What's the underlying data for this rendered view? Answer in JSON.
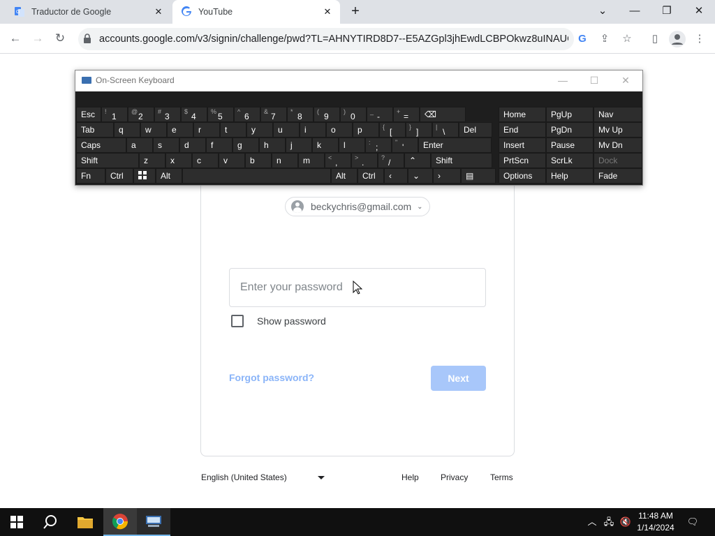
{
  "browser": {
    "tabs": [
      {
        "title": "Traductor de Google",
        "active": false
      },
      {
        "title": "YouTube",
        "active": true
      }
    ],
    "new_tab_glyph": "+",
    "url": "accounts.google.com/v3/signin/challenge/pwd?TL=AHNYTIRD8D7--E5AZGpl3jhEwdLCBPOkwz8uINAUOPB..."
  },
  "osk": {
    "title": "On-Screen Keyboard",
    "keys": {
      "row1": [
        "Esc",
        "1",
        "2",
        "3",
        "4",
        "5",
        "6",
        "7",
        "8",
        "9",
        "0",
        "-",
        "="
      ],
      "row1_shift": [
        "~ `",
        "!",
        "@",
        "#",
        "$",
        "%",
        "^",
        "&",
        "*",
        "(",
        ")",
        "_",
        "+"
      ],
      "row2": [
        "Tab",
        "q",
        "w",
        "e",
        "r",
        "t",
        "y",
        "u",
        "i",
        "o",
        "p",
        "[",
        "]",
        "\\",
        "Del"
      ],
      "row2_shift": [
        "",
        "",
        "",
        "",
        "",
        "",
        "",
        "",
        "",
        "",
        "",
        "{",
        "}",
        "|",
        ""
      ],
      "row3": [
        "Caps",
        "a",
        "s",
        "d",
        "f",
        "g",
        "h",
        "j",
        "k",
        "l",
        ";",
        "'",
        "Enter"
      ],
      "row3_shift": [
        "",
        "",
        "",
        "",
        "",
        "",
        "",
        "",
        "",
        "",
        ":",
        "\"",
        ""
      ],
      "row4": [
        "Shift",
        "z",
        "x",
        "c",
        "v",
        "b",
        "n",
        "m",
        ",",
        ".",
        "/",
        "",
        "Shift"
      ],
      "row4_shift": [
        "",
        "",
        "",
        "",
        "",
        "",
        "",
        "",
        "<",
        ">",
        "?",
        "",
        ""
      ],
      "row5": [
        "Fn",
        "Ctrl",
        "",
        "Alt",
        "",
        "Alt",
        "Ctrl",
        "",
        "",
        "",
        ""
      ],
      "nav": [
        [
          "Home",
          "PgUp",
          "Nav"
        ],
        [
          "End",
          "PgDn",
          "Mv Up"
        ],
        [
          "Insert",
          "Pause",
          "Mv Dn"
        ],
        [
          "PrtScn",
          "ScrLk",
          "Dock"
        ],
        [
          "Options",
          "Help",
          "Fade"
        ]
      ]
    }
  },
  "signin": {
    "account_email": "beckychris@gmail.com",
    "password_placeholder": "Enter your password",
    "show_password_label": "Show password",
    "forgot_password": "Forgot password?",
    "next_label": "Next"
  },
  "footer": {
    "language": "English (United States)",
    "links": [
      "Help",
      "Privacy",
      "Terms"
    ]
  },
  "taskbar": {
    "time": "11:48 AM",
    "date": "1/14/2024"
  },
  "colors": {
    "accent_blue": "#1a73e8",
    "next_disabled": "#a8c7fa",
    "osk_bg": "#1e1e1e",
    "osk_key": "#2d2d2d"
  }
}
